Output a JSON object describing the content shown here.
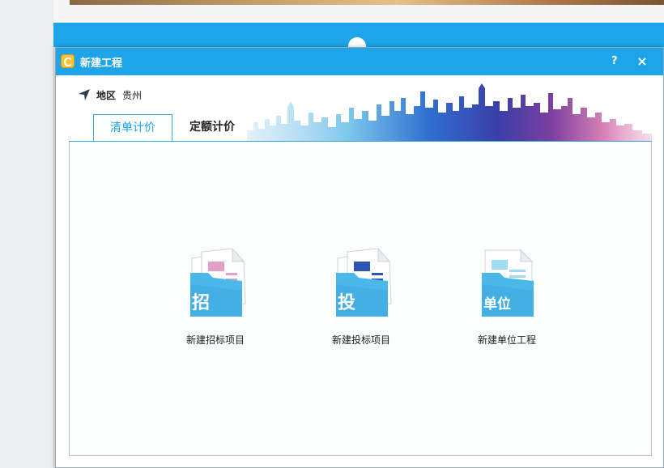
{
  "dialog": {
    "title": "新建工程",
    "help_label": "?",
    "close_label": "×"
  },
  "region": {
    "label": "地区",
    "value": "贵州"
  },
  "tabs": [
    {
      "label": "清单计价",
      "active": true
    },
    {
      "label": "定额计价",
      "active": false
    }
  ],
  "actions": [
    {
      "label": "新建招标项目",
      "icon_char": "招",
      "icon": "tender-folder-icon"
    },
    {
      "label": "新建投标项目",
      "icon_char": "投",
      "icon": "bid-folder-icon"
    },
    {
      "label": "新建单位工程",
      "icon_char": "单位",
      "icon": "unit-project-folder-icon"
    }
  ],
  "colors": {
    "accent": "#1ea4e8",
    "folder": "#4bb8ea",
    "pink": "#e0a0c8",
    "navy": "#2f55b4",
    "light_blue": "#9fdcf4"
  }
}
